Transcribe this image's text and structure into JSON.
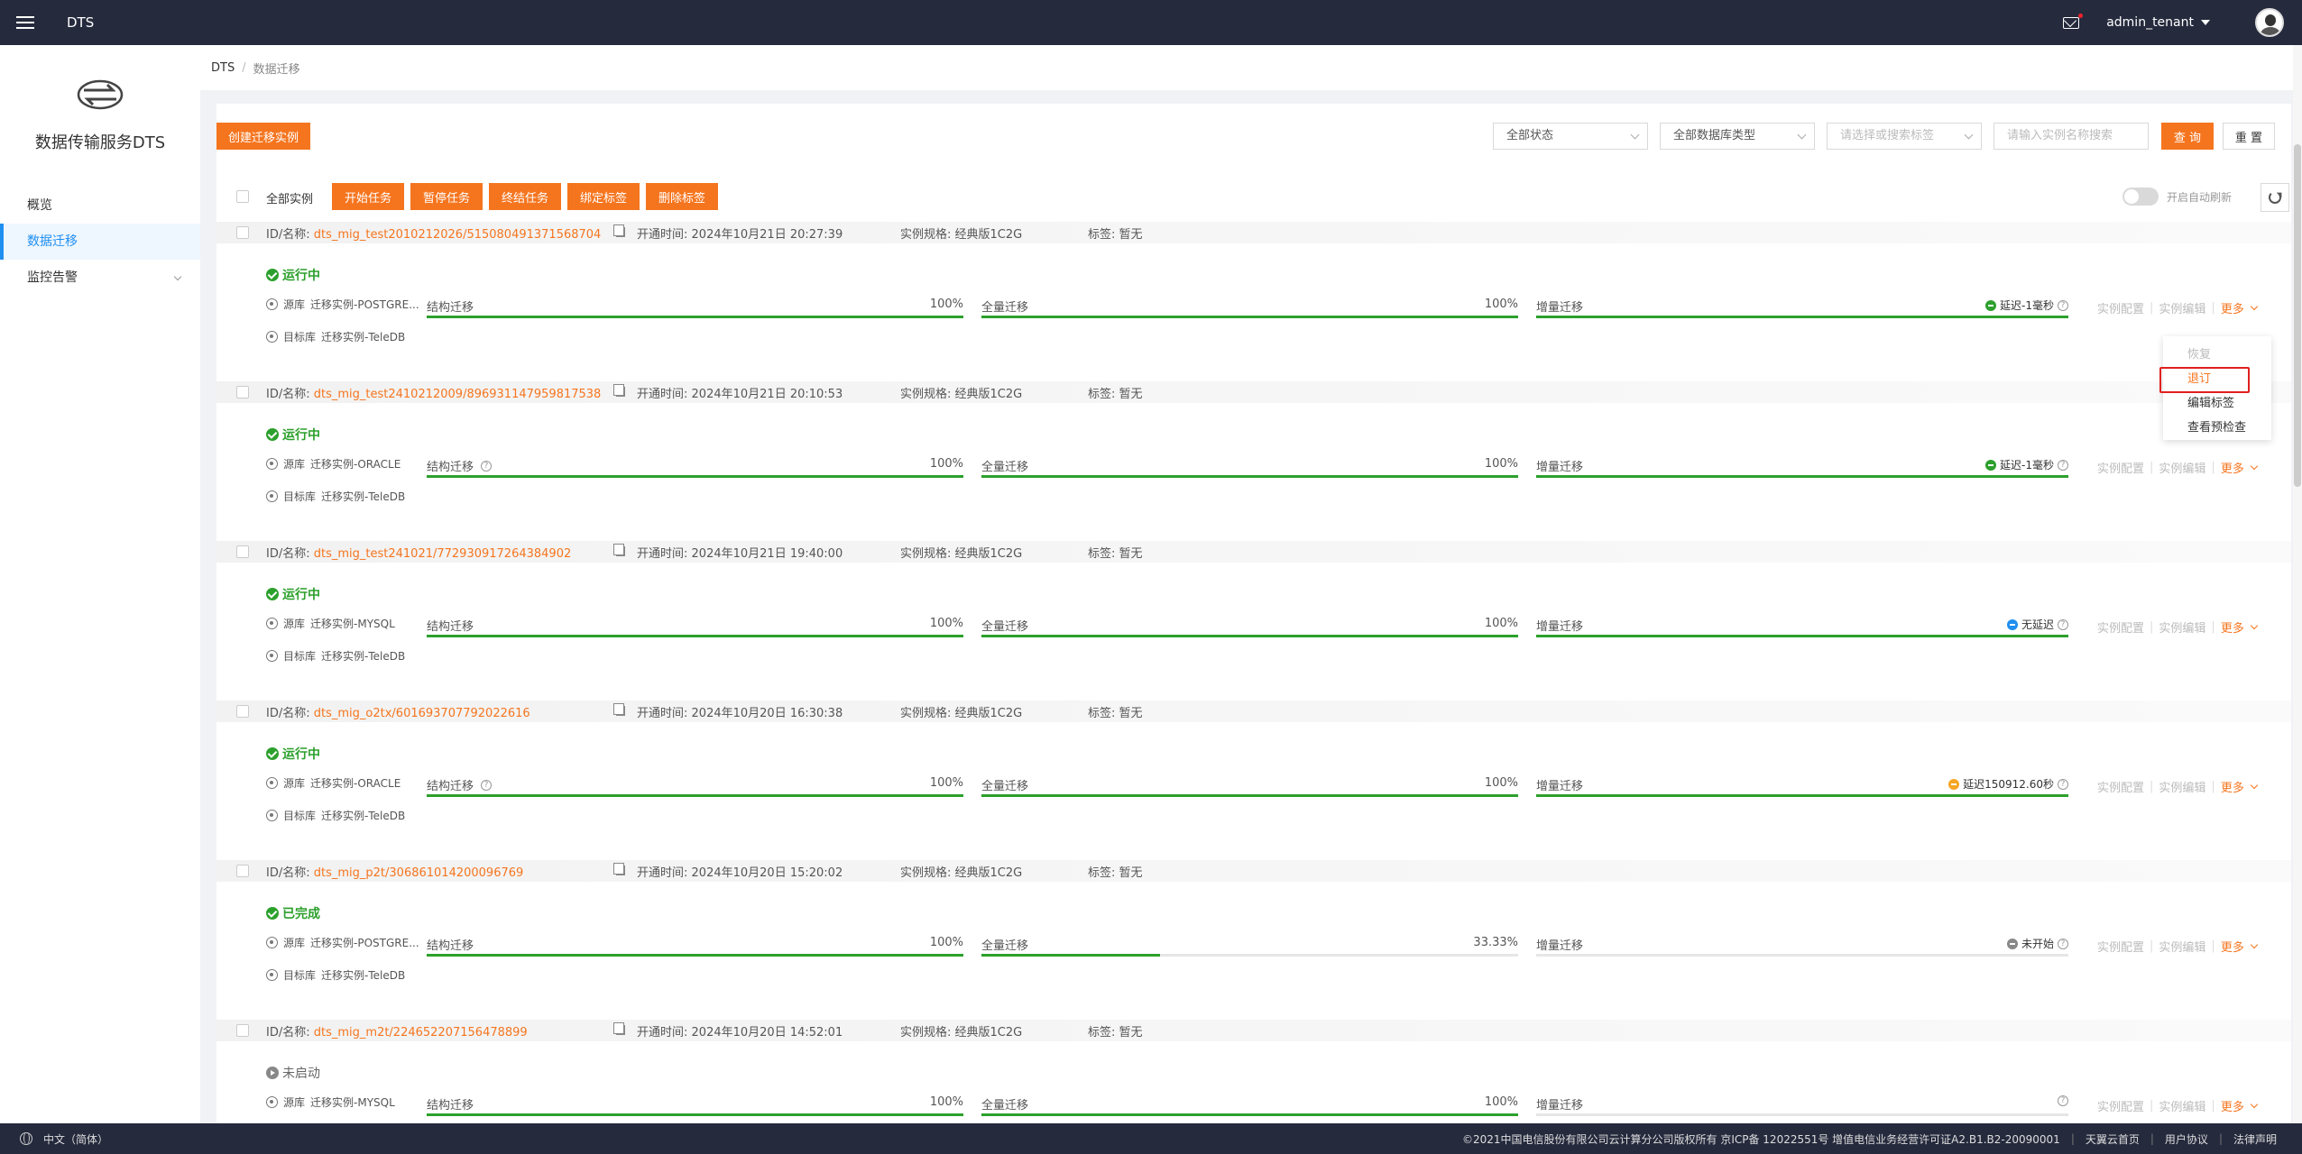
{
  "topbar": {
    "brand": "DTS",
    "username": "admin_tenant",
    "icons": [
      "menu-icon",
      "mail-icon",
      "avatar"
    ]
  },
  "sidebar": {
    "product_name": "数据传输服务DTS",
    "items": [
      {
        "label": "概览",
        "active": false
      },
      {
        "label": "数据迁移",
        "active": true
      },
      {
        "label": "监控告警",
        "active": false
      }
    ]
  },
  "breadcrumb": {
    "root": "DTS",
    "sep": "/",
    "current": "数据迁移"
  },
  "toolbar": {
    "create_label": "创建迁移实例",
    "filter_status": "全部状态",
    "filter_dbtype": "全部数据库类型",
    "filter_tag_placeholder": "请选择或搜索标签",
    "search_placeholder": "请输入实例名称搜索",
    "query_label": "查 询",
    "reset_label": "重 置",
    "select_all_label": "全部实例",
    "batch": [
      "开始任务",
      "暂停任务",
      "终结任务",
      "绑定标签",
      "删除标签"
    ],
    "auto_refresh_label": "开启自动刷新"
  },
  "labels": {
    "id_prefix": "ID/名称:",
    "time_prefix": "开通时间:",
    "spec_prefix": "实例规格:",
    "tag_prefix": "标签:",
    "src_prefix": "源库",
    "dst_prefix": "目标库",
    "stage_struct": "结构迁移",
    "stage_full": "全量迁移",
    "stage_incr": "增量迁移",
    "action_config": "实例配置",
    "action_edit": "实例编辑",
    "action_more": "更多",
    "action_sep": "|"
  },
  "instances": [
    {
      "id": "dts_mig_test2010212026/515080491371568704",
      "time": "2024年10月21日 20:27:39",
      "spec": "经典版1C2G",
      "tag": "暂无",
      "status": "运行中",
      "status_kind": "running",
      "source": "迁移实例-POSTGRE...",
      "target": "迁移实例-TeleDB",
      "struct_pct": "100%",
      "struct_progress": 1.0,
      "struct_help": false,
      "full_pct": "100%",
      "full_progress": 1.0,
      "incr_progress": 1.0,
      "latency": "延迟-1毫秒",
      "latency_color": "#2ca02c"
    },
    {
      "id": "dts_mig_test2410212009/896931147959817538",
      "time": "2024年10月21日 20:10:53",
      "spec": "经典版1C2G",
      "tag": "暂无",
      "status": "运行中",
      "status_kind": "running",
      "source": "迁移实例-ORACLE",
      "target": "迁移实例-TeleDB",
      "struct_pct": "100%",
      "struct_progress": 1.0,
      "struct_help": true,
      "full_pct": "100%",
      "full_progress": 1.0,
      "incr_progress": 1.0,
      "latency": "延迟-1毫秒",
      "latency_color": "#2ca02c"
    },
    {
      "id": "dts_mig_test241021/772930917264384902",
      "time": "2024年10月21日 19:40:00",
      "spec": "经典版1C2G",
      "tag": "暂无",
      "status": "运行中",
      "status_kind": "running",
      "source": "迁移实例-MYSQL",
      "target": "迁移实例-TeleDB",
      "struct_pct": "100%",
      "struct_progress": 1.0,
      "struct_help": false,
      "full_pct": "100%",
      "full_progress": 1.0,
      "incr_progress": 1.0,
      "latency": "无延迟",
      "latency_color": "#1f8ff0"
    },
    {
      "id": "dts_mig_o2tx/601693707792022616",
      "time": "2024年10月20日 16:30:38",
      "spec": "经典版1C2G",
      "tag": "暂无",
      "status": "运行中",
      "status_kind": "running",
      "source": "迁移实例-ORACLE",
      "target": "迁移实例-TeleDB",
      "struct_pct": "100%",
      "struct_progress": 1.0,
      "struct_help": true,
      "full_pct": "100%",
      "full_progress": 1.0,
      "incr_progress": 1.0,
      "latency": "延迟150912.60秒",
      "latency_color": "#f5a623"
    },
    {
      "id": "dts_mig_p2t/306861014200096769",
      "time": "2024年10月20日 15:20:02",
      "spec": "经典版1C2G",
      "tag": "暂无",
      "status": "已完成",
      "status_kind": "running",
      "source": "迁移实例-POSTGRE...",
      "target": "迁移实例-TeleDB",
      "struct_pct": "100%",
      "struct_progress": 1.0,
      "struct_help": false,
      "full_pct": "33.33%",
      "full_progress": 0.3333,
      "incr_progress": 0.0,
      "latency": "未开始",
      "latency_color": "#888888"
    },
    {
      "id": "dts_mig_m2t/224652207156478899",
      "time": "2024年10月20日 14:52:01",
      "spec": "经典版1C2G",
      "tag": "暂无",
      "status": "未启动",
      "status_kind": "stopped",
      "source": "迁移实例-MYSQL",
      "target": "",
      "struct_pct": "100%",
      "struct_progress": 1.0,
      "struct_help": false,
      "full_pct": "100%",
      "full_progress": 1.0,
      "incr_progress": 0.0,
      "latency": "",
      "latency_color": ""
    }
  ],
  "more_menu": {
    "items": [
      {
        "label": "恢复",
        "state": "disabled"
      },
      {
        "label": "退订",
        "state": "highlight"
      },
      {
        "label": "编辑标签",
        "state": "normal"
      },
      {
        "label": "查看预检查",
        "state": "normal"
      }
    ]
  },
  "footer": {
    "language": "中文（简体）",
    "copyright": "©2021中国电信股份有限公司云计算分公司版权所有 京ICP备 12022551号 增值电信业务经营许可证A2.B1.B2-20090001",
    "links": [
      "天翼云首页",
      "用户协议",
      "法律声明"
    ]
  },
  "colors": {
    "accent": "#f5751f",
    "topbar": "#252a3d",
    "success": "#2ca02c",
    "active_nav": "#1f8ff0"
  }
}
